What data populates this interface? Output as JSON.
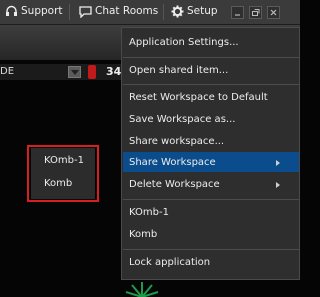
{
  "toolbar": {
    "support_label": "Support",
    "chat_label": "Chat Rooms",
    "setup_label": "Setup"
  },
  "status": {
    "dropdown_value": "DE",
    "number_value": "34"
  },
  "submenu": {
    "items": [
      "KOmb-1",
      "Komb"
    ]
  },
  "menu": {
    "items": [
      "Application Settings...",
      "Open shared item...",
      "Reset Workspace to Default",
      "Save Workspace as...",
      "Share workspace...",
      "Share Workspace",
      "Delete Workspace",
      "KOmb-1",
      "Komb",
      "Lock application"
    ]
  },
  "colors": {
    "highlight": "#0b4d8c",
    "callout_border": "#d71f1f",
    "background": "#050505"
  }
}
